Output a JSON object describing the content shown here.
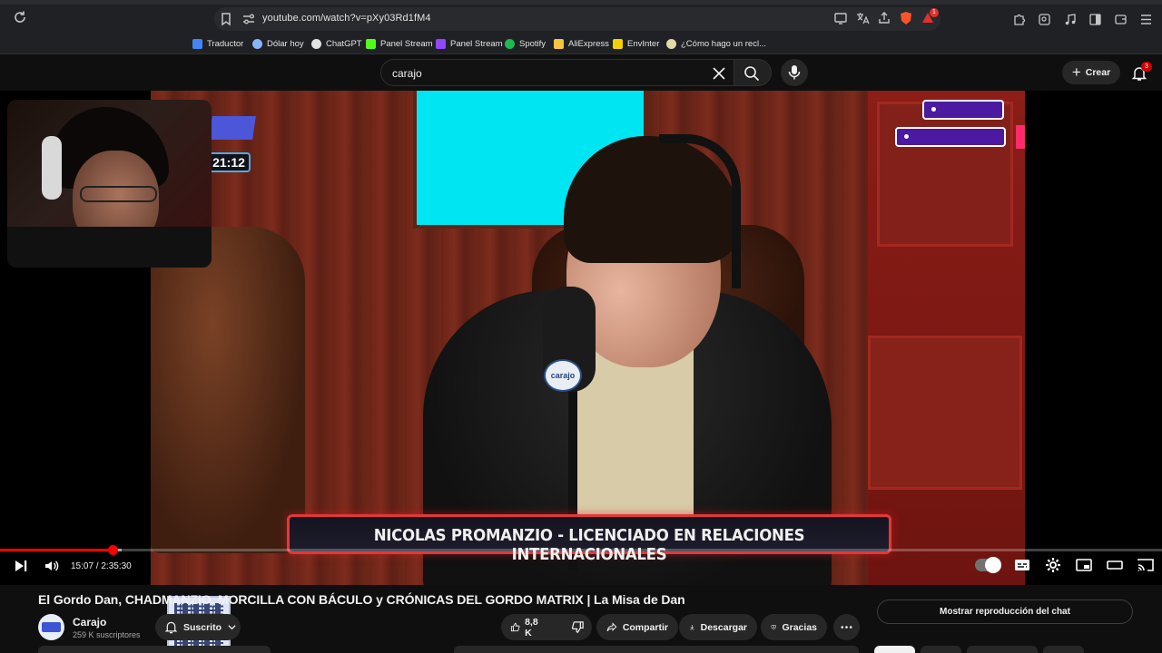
{
  "browser": {
    "url": "youtube.com/watch?v=pXy03Rd1fM4",
    "brave_badge": "1",
    "bookmarks": [
      {
        "label": "Traductor",
        "color": "#4285f4"
      },
      {
        "label": "Dólar hoy",
        "color": "#8ab4f8"
      },
      {
        "label": "ChatGPT",
        "color": "#e3e3e3"
      },
      {
        "label": "Panel Stream",
        "color": "#53fc18"
      },
      {
        "label": "Panel Stream",
        "color": "#9146ff"
      },
      {
        "label": "Spotify",
        "color": "#1db954"
      },
      {
        "label": "AliExpress",
        "color": "#f5c542"
      },
      {
        "label": "EnvInter",
        "color": "#f5d000"
      },
      {
        "label": "¿Cómo hago un recl...",
        "color": "#e3d9a8"
      }
    ]
  },
  "youtube": {
    "search_query": "carajo",
    "create_label": "Crear",
    "notifications_count": "3"
  },
  "player": {
    "stream_timer": "21:12",
    "lower_third": "NICOLAS PROMANZIO - LICENCIADO EN RELACIONES INTERNACIONALES",
    "mic_flag_text": "carajo",
    "current_time": "15:07 / 2:35:30",
    "progress_fraction": 0.0971,
    "buffered_fraction": 0.0078
  },
  "video": {
    "title": "El Gordo Dan, CHADMANZIO, MORCILLA CON BÁCULO y CRÓNICAS DEL GORDO MATRIX | La Misa de Dan",
    "channel_name": "Carajo",
    "subscribers": "259 K suscriptores",
    "subscribed_label": "Suscrito",
    "likes": "8,8 K",
    "share_label": "Compartir",
    "download_label": "Descargar",
    "thanks_label": "Gracias",
    "chat_replay_label": "Mostrar reproducción del chat"
  },
  "colors": {
    "youtube_red": "#ff0000",
    "background": "#0f0f0f",
    "chip": "#272727"
  }
}
